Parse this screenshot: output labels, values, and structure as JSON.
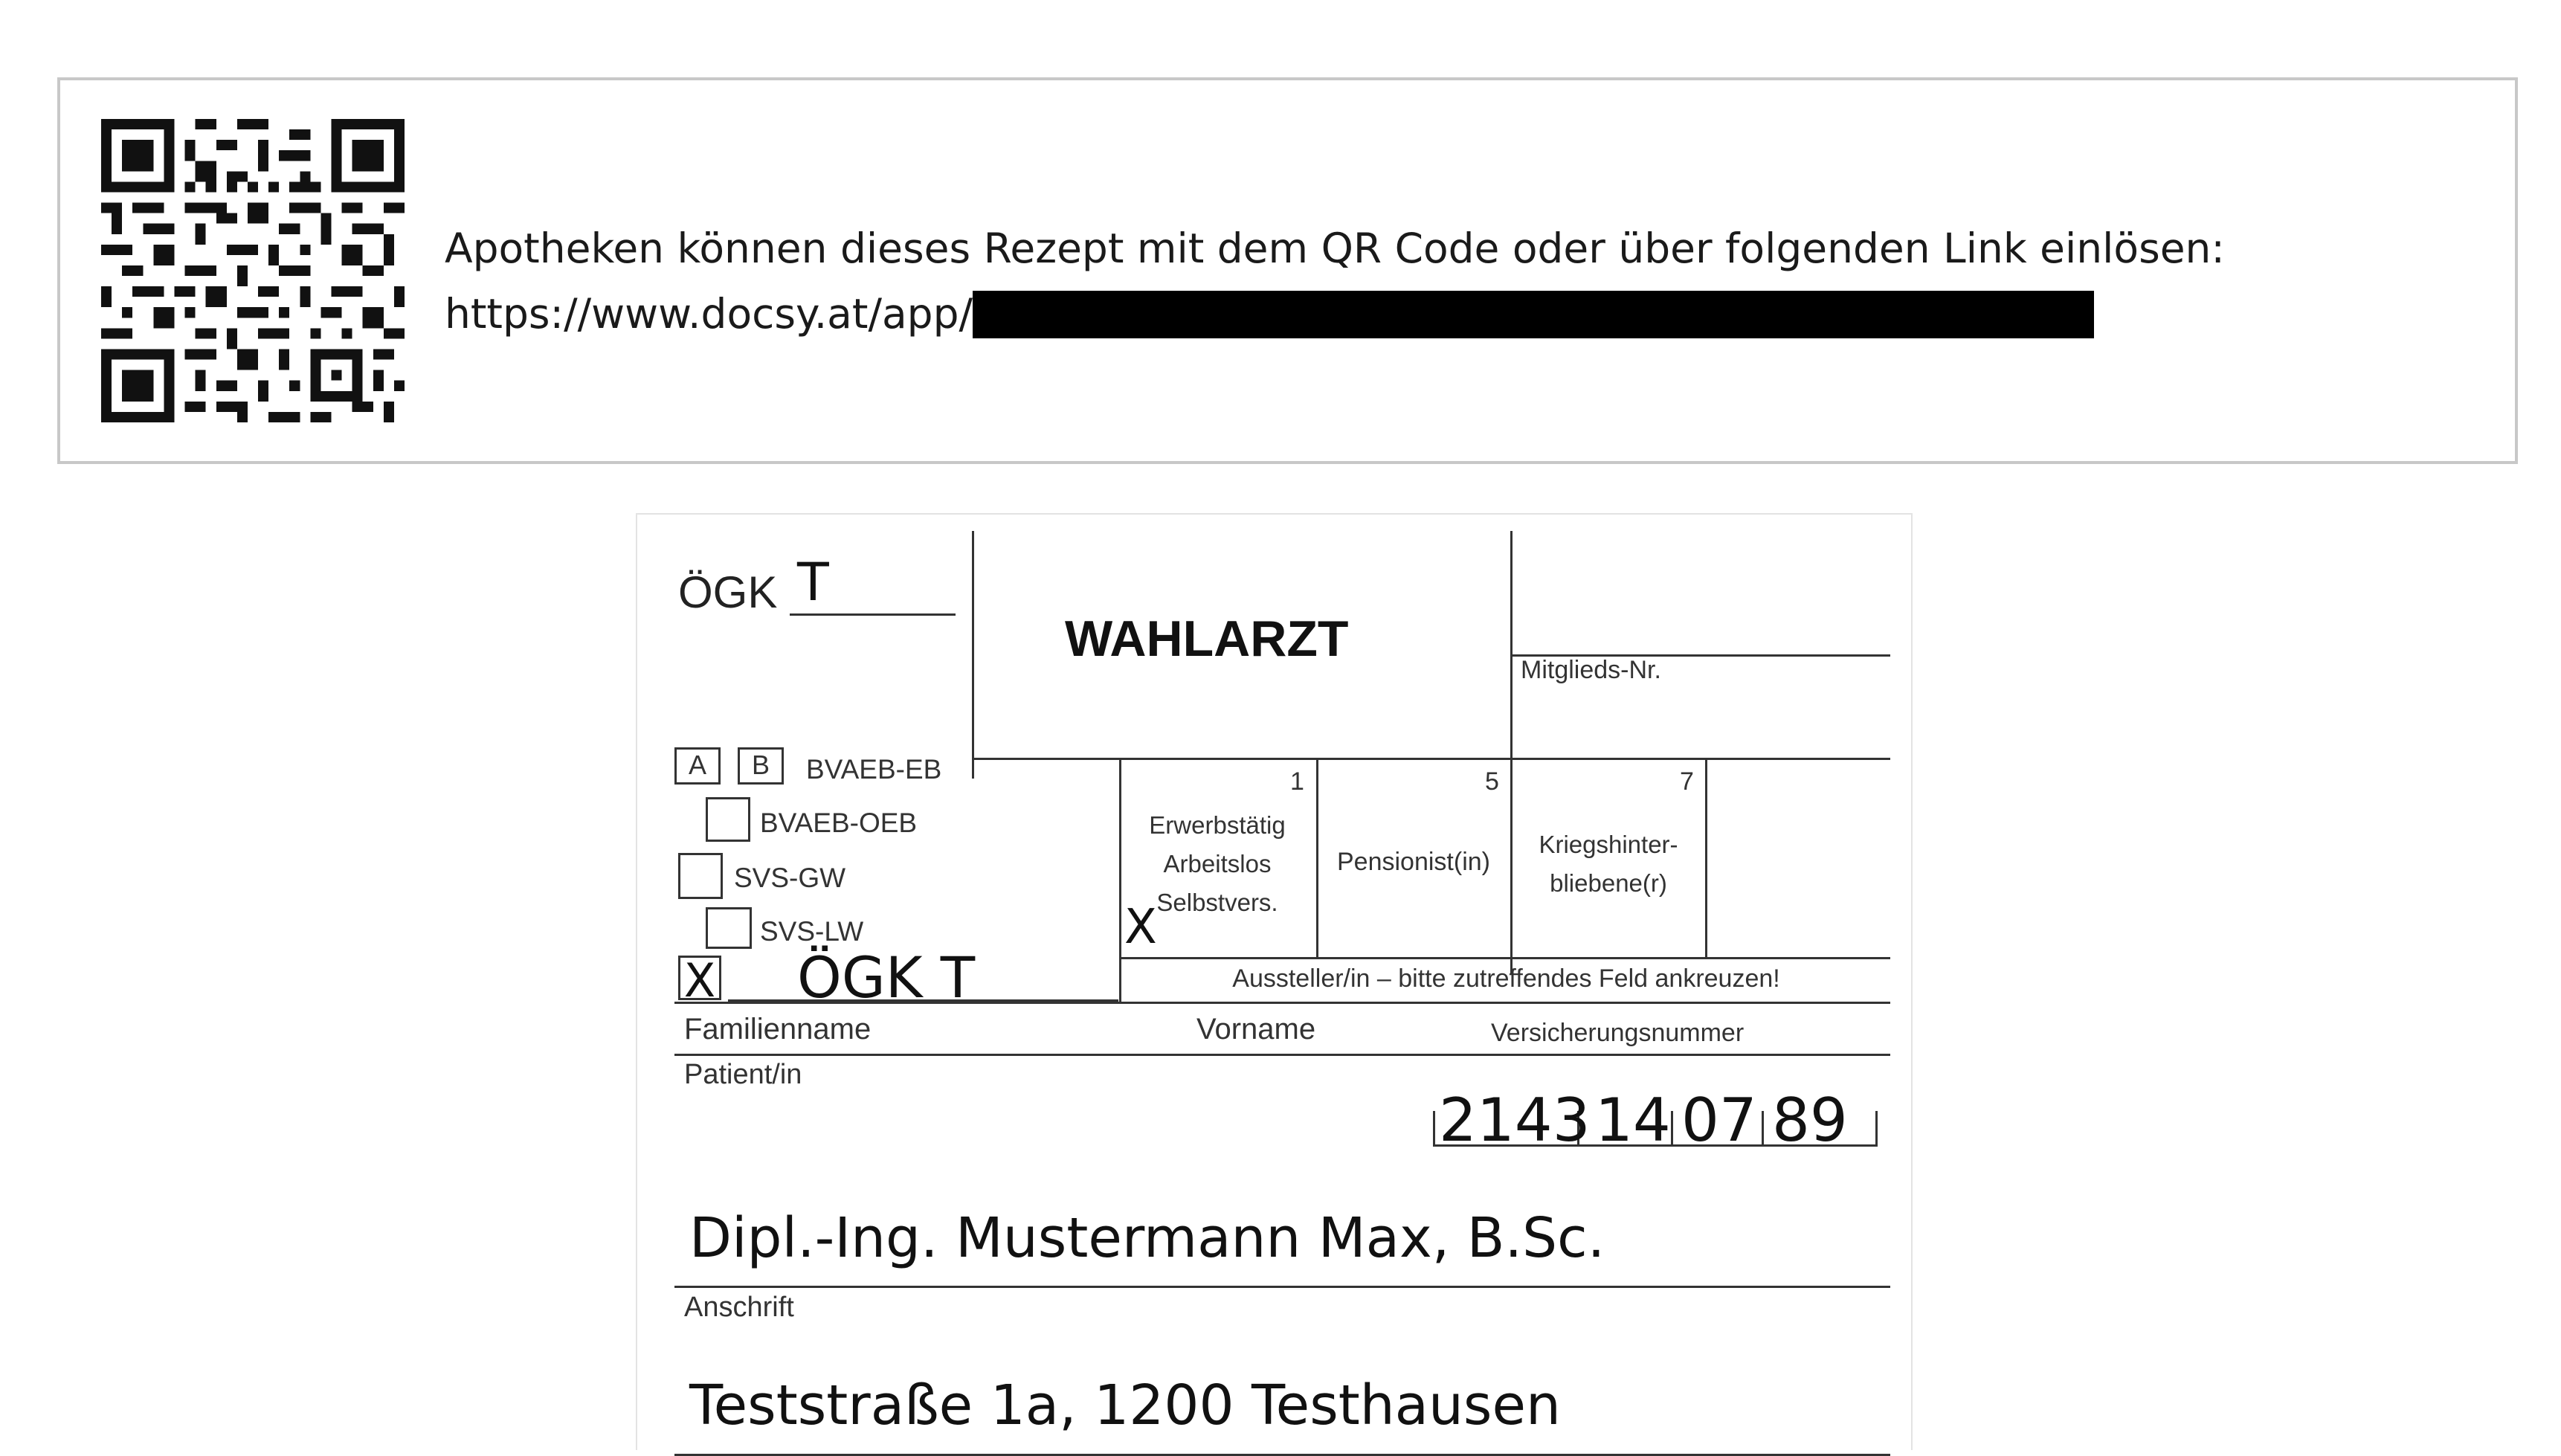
{
  "banner": {
    "line1": "Apotheken können dieses Rezept mit dem QR Code oder über folgenden Link einlösen:",
    "link_prefix": "https://www.docsy.at/app/"
  },
  "form": {
    "insurer_label": "ÖGK",
    "insurer_value": "T",
    "title": "WAHLARZT",
    "member_no_label": "Mitglieds-Nr.",
    "box_a": "A",
    "box_b": "B",
    "bvaeb_eb": "BVAEB-EB",
    "bvaeb_oeb": "BVAEB-OEB",
    "svs_gw": "SVS-GW",
    "svs_lw": "SVS-LW",
    "checked_mark": "X",
    "checked_value": "ÖGK T",
    "cat1_num": "1",
    "cat1_l1": "Erwerbstätig",
    "cat1_l2": "Arbeitslos",
    "cat1_l3": "Selbstvers.",
    "cat1_mark": "X",
    "cat5_num": "5",
    "cat5_label": "Pensionist(in)",
    "cat7_num": "7",
    "cat7_l1": "Kriegshinter-",
    "cat7_l2": "bliebene(r)",
    "issuer_note": "Aussteller/in – bitte zutreffendes Feld ankreuzen!",
    "col_family": "Familienname",
    "col_first": "Vorname",
    "col_ssn": "Versicherungsnummer",
    "patient_label": "Patient/in",
    "ssn_part1": "2143",
    "ssn_part2": "14",
    "ssn_part3": "07",
    "ssn_part4": "89",
    "patient_name": "Dipl.-Ing. Mustermann Max, B.Sc.",
    "address_label": "Anschrift",
    "address_value": "Teststraße 1a, 1200 Testhausen"
  }
}
